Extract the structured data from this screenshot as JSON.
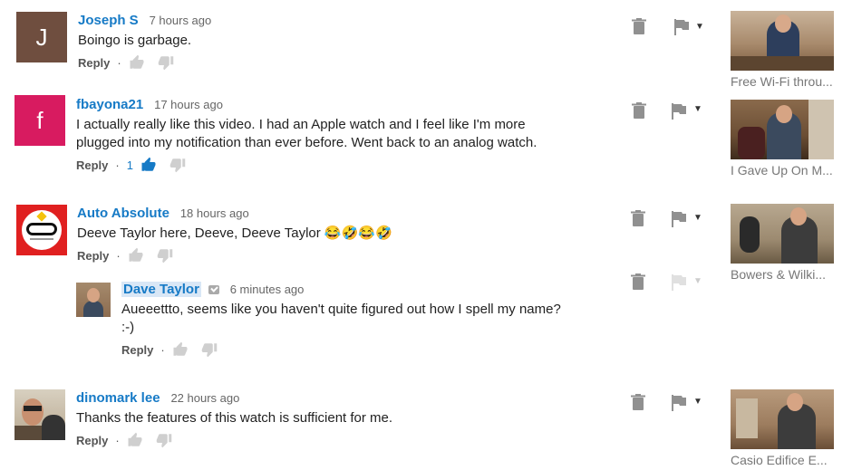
{
  "reply_label": "Reply",
  "colors": {
    "author": "#167ac6",
    "icon": "#909090",
    "icon_light": "#cfcfcf"
  },
  "comments": [
    {
      "author": "Joseph S",
      "time": "7 hours ago",
      "text": "Boingo is garbage.",
      "avatar_letter": "J",
      "avatar_color": "#6f4e3f",
      "likes": "",
      "video_title": "Free Wi-Fi throu..."
    },
    {
      "author": "fbayona21",
      "time": "17 hours ago",
      "text": "I actually really like this video. I had an Apple watch and I feel like I'm more\nplugged into my notification than ever before. Went back to an analog watch.",
      "avatar_letter": "f",
      "avatar_color": "#d81b60",
      "likes": "1",
      "video_title": "I Gave Up On M..."
    },
    {
      "author": "Auto Absolute",
      "time": "18 hours ago",
      "text": "Deeve Taylor here, Deeve, Deeve Taylor 😂🤣😂🤣",
      "avatar_icon": "auto-absolute-logo-icon",
      "likes": "",
      "video_title": "Bowers & Wilki..."
    },
    {
      "author": "Dave Taylor",
      "time": "6 minutes ago",
      "text": "Aueeettto, seems like you haven't quite figured out how I spell my name?\n:-)",
      "avatar_icon": "dave-taylor-photo-icon",
      "likes": "",
      "is_reply": true
    },
    {
      "author": "dinomark lee",
      "time": "22 hours ago",
      "text": "Thanks the features of this watch is sufficient for me.",
      "avatar_icon": "dinomark-photo-icon",
      "likes": "",
      "video_title": "Casio Edifice E..."
    }
  ]
}
